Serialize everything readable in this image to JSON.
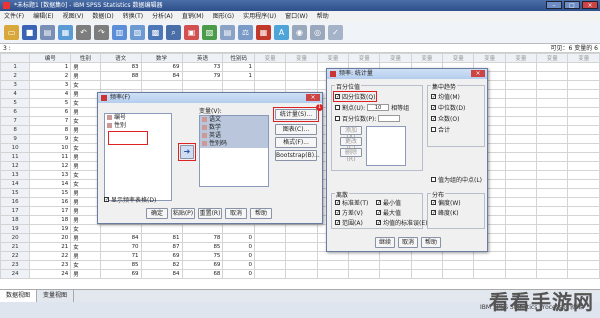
{
  "window": {
    "title": "*未标题1 [数据集0] - IBM SPSS Statistics 数据编辑器"
  },
  "menu": [
    "文件(F)",
    "编辑(E)",
    "视图(V)",
    "数据(D)",
    "转换(T)",
    "分析(A)",
    "直销(M)",
    "图形(G)",
    "实用程序(U)",
    "窗口(W)",
    "帮助"
  ],
  "cellbar": {
    "ref": "3 :",
    "visible": "可见：6 变量的 6"
  },
  "grid": {
    "columns": [
      "编号",
      "性别",
      "语文",
      "数学",
      "英语",
      "性别码",
      "变量",
      "变量",
      "变量",
      "变量",
      "变量",
      "变量",
      "变量",
      "变量",
      "变量",
      "变量",
      "变量"
    ],
    "rows": [
      [
        "1",
        "1",
        "男",
        "83",
        "69",
        "73",
        "1"
      ],
      [
        "2",
        "2",
        "男",
        "88",
        "84",
        "79",
        "1"
      ],
      [
        "3",
        "3",
        "女",
        "",
        "",
        "",
        ""
      ],
      [
        "4",
        "4",
        "男",
        "",
        "",
        "",
        ""
      ],
      [
        "5",
        "5",
        "女",
        "",
        "",
        "",
        ""
      ],
      [
        "6",
        "6",
        "男",
        "",
        "",
        "",
        ""
      ],
      [
        "7",
        "7",
        "女",
        "",
        "",
        "",
        ""
      ],
      [
        "8",
        "8",
        "男",
        "",
        "",
        "",
        ""
      ],
      [
        "9",
        "9",
        "女",
        "",
        "",
        "",
        ""
      ],
      [
        "10",
        "10",
        "女",
        "",
        "",
        "",
        ""
      ],
      [
        "11",
        "11",
        "男",
        "",
        "",
        "",
        ""
      ],
      [
        "12",
        "12",
        "男",
        "",
        "",
        "",
        ""
      ],
      [
        "13",
        "13",
        "女",
        "",
        "",
        "",
        ""
      ],
      [
        "14",
        "14",
        "女",
        "",
        "",
        "",
        ""
      ],
      [
        "15",
        "15",
        "男",
        "",
        "",
        "",
        ""
      ],
      [
        "16",
        "16",
        "男",
        "",
        "",
        "",
        ""
      ],
      [
        "17",
        "17",
        "男",
        "",
        "",
        "",
        ""
      ],
      [
        "18",
        "18",
        "男",
        "",
        "",
        "",
        ""
      ],
      [
        "19",
        "19",
        "女",
        "",
        "",
        "",
        ""
      ],
      [
        "20",
        "20",
        "男",
        "84",
        "81",
        "78",
        "0"
      ],
      [
        "21",
        "21",
        "女",
        "70",
        "87",
        "85",
        "0"
      ],
      [
        "22",
        "22",
        "男",
        "71",
        "69",
        "75",
        "0"
      ],
      [
        "23",
        "23",
        "女",
        "85",
        "82",
        "69",
        "0"
      ],
      [
        "24",
        "24",
        "男",
        "69",
        "84",
        "68",
        "0"
      ]
    ]
  },
  "freq_dialog": {
    "title": "频率(F)",
    "source_vars": [
      "编号",
      "性别"
    ],
    "target_label": "变量(V):",
    "target_vars": [
      "语文",
      "数学",
      "英语",
      "性别码"
    ],
    "side_buttons": [
      "统计量(S)...",
      "图表(C)...",
      "格式(F)...",
      "Bootstrap(B)..."
    ],
    "show_tables": "显示频率表格(D)",
    "buttons": [
      "确定",
      "粘贴(P)",
      "重置(R)",
      "取消",
      "帮助"
    ]
  },
  "stats_dialog": {
    "title": "频率: 统计量",
    "percentile_group": "百分位值",
    "quartiles": "四分位数(Q)",
    "cut_points": "割点(U):",
    "cut_value": "10",
    "equal_groups": "相等组",
    "percentile": "百分位数(P):",
    "pct_buttons": [
      "添加(A)",
      "更改(C)",
      "删除(R)"
    ],
    "central_group": "集中趋势",
    "central": [
      "均值(M)",
      "中位数(D)",
      "众数(O)",
      "合计"
    ],
    "grouped_mid": "值为组的中点(L)",
    "dispersion_group": "离散",
    "dispersion": [
      "标准差(T)",
      "最小值",
      "方差(V)",
      "最大值",
      "范围(A)",
      "均值的标准误(E)"
    ],
    "distribution_group": "分布",
    "distribution": [
      "偏度(W)",
      "峰度(K)"
    ],
    "buttons": [
      "继续",
      "取消",
      "帮助"
    ]
  },
  "tabs": [
    "数据视图",
    "变量视图"
  ],
  "status": {
    "processor": "IBM SPSS Statistics Processor 就绪"
  },
  "watermark": "看看手游网",
  "badge": "1"
}
